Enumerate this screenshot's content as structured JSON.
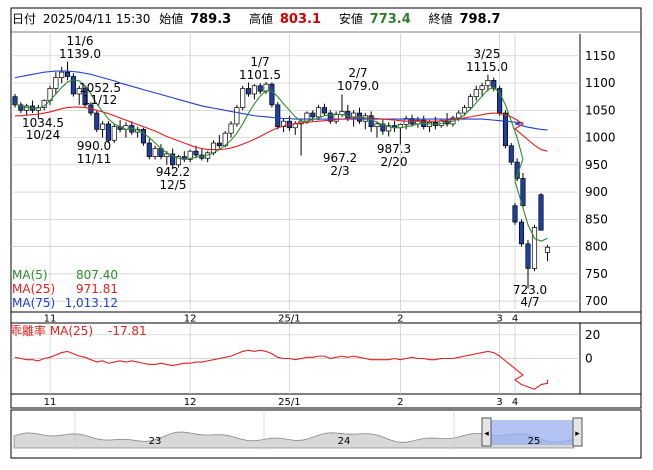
{
  "header": {
    "date_label": "日付",
    "date_value": "2025/04/11 15:30",
    "open_label": "始値",
    "open_value": "789.3",
    "high_label": "高値",
    "high_value": "803.1",
    "low_label": "安値",
    "low_value": "773.4",
    "close_label": "終値",
    "close_value": "798.7"
  },
  "colors": {
    "up_candle": "#ffffff",
    "down_candle": "#1f3f9f",
    "ma5": "#2e8b2e",
    "ma25": "#e02020",
    "ma75": "#2040d0",
    "deviation": "#e02020",
    "grid": "#c8c8c8",
    "scroller_fill": "#9ab0f0"
  },
  "chart_data": [
    {
      "type": "candlestick",
      "title": "",
      "ylim": [
        680,
        1190
      ],
      "y_ticks": [
        "1150",
        "1100",
        "1050",
        "1000",
        "950",
        "900",
        "850",
        "800",
        "750",
        "700"
      ],
      "x_labels": [
        "11",
        "12",
        "25/1",
        "2",
        "3",
        "4"
      ],
      "grid": true,
      "annotations": [
        {
          "price": "1139.0",
          "date": "11/6"
        },
        {
          "price": "1052.5",
          "date": "11/12"
        },
        {
          "price": "1034.5",
          "date": "10/24"
        },
        {
          "price": "990.0",
          "date": "11/11"
        },
        {
          "price": "942.2",
          "date": "12/5"
        },
        {
          "price": "1101.5",
          "date": "1/7"
        },
        {
          "price": "1079.0",
          "date": "2/7"
        },
        {
          "price": "967.2",
          "date": "2/3"
        },
        {
          "price": "987.3",
          "date": "2/20"
        },
        {
          "price": "1115.0",
          "date": "3/25"
        },
        {
          "price": "723.0",
          "date": "4/7"
        }
      ],
      "legend": [
        {
          "name": "MA(5)",
          "value": "807.40",
          "color": "#2e8b2e"
        },
        {
          "name": "MA(25)",
          "value": "971.81",
          "color": "#e02020"
        },
        {
          "name": "MA(75)",
          "value": "1,013.12",
          "color": "#2040d0"
        }
      ],
      "candles": [
        {
          "o": 1075,
          "h": 1080,
          "l": 1055,
          "c": 1060
        },
        {
          "o": 1060,
          "h": 1065,
          "l": 1045,
          "c": 1050
        },
        {
          "o": 1050,
          "h": 1062,
          "l": 1040,
          "c": 1058
        },
        {
          "o": 1058,
          "h": 1068,
          "l": 1045,
          "c": 1050
        },
        {
          "o": 1050,
          "h": 1060,
          "l": 1035,
          "c": 1055
        },
        {
          "o": 1055,
          "h": 1070,
          "l": 1050,
          "c": 1068
        },
        {
          "o": 1068,
          "h": 1095,
          "l": 1060,
          "c": 1090
        },
        {
          "o": 1090,
          "h": 1120,
          "l": 1080,
          "c": 1110
        },
        {
          "o": 1110,
          "h": 1130,
          "l": 1100,
          "c": 1120
        },
        {
          "o": 1120,
          "h": 1139,
          "l": 1105,
          "c": 1112
        },
        {
          "o": 1112,
          "h": 1118,
          "l": 1075,
          "c": 1080
        },
        {
          "o": 1080,
          "h": 1095,
          "l": 1060,
          "c": 1090
        },
        {
          "o": 1090,
          "h": 1095,
          "l": 1055,
          "c": 1060
        },
        {
          "o": 1060,
          "h": 1065,
          "l": 1040,
          "c": 1045
        },
        {
          "o": 1045,
          "h": 1050,
          "l": 1010,
          "c": 1015
        },
        {
          "o": 1015,
          "h": 1030,
          "l": 1000,
          "c": 1025
        },
        {
          "o": 1025,
          "h": 1030,
          "l": 990,
          "c": 995
        },
        {
          "o": 995,
          "h": 1025,
          "l": 990,
          "c": 1020
        },
        {
          "o": 1020,
          "h": 1032,
          "l": 1010,
          "c": 1015
        },
        {
          "o": 1015,
          "h": 1028,
          "l": 1000,
          "c": 1022
        },
        {
          "o": 1022,
          "h": 1030,
          "l": 1005,
          "c": 1010
        },
        {
          "o": 1010,
          "h": 1020,
          "l": 1000,
          "c": 1015
        },
        {
          "o": 1015,
          "h": 1018,
          "l": 985,
          "c": 990
        },
        {
          "o": 990,
          "h": 998,
          "l": 960,
          "c": 965
        },
        {
          "o": 965,
          "h": 985,
          "l": 960,
          "c": 980
        },
        {
          "o": 980,
          "h": 988,
          "l": 960,
          "c": 965
        },
        {
          "o": 965,
          "h": 975,
          "l": 950,
          "c": 970
        },
        {
          "o": 970,
          "h": 980,
          "l": 942,
          "c": 950
        },
        {
          "o": 950,
          "h": 968,
          "l": 945,
          "c": 965
        },
        {
          "o": 965,
          "h": 975,
          "l": 955,
          "c": 960
        },
        {
          "o": 960,
          "h": 978,
          "l": 955,
          "c": 975
        },
        {
          "o": 975,
          "h": 985,
          "l": 962,
          "c": 968
        },
        {
          "o": 968,
          "h": 980,
          "l": 958,
          "c": 962
        },
        {
          "o": 962,
          "h": 975,
          "l": 955,
          "c": 972
        },
        {
          "o": 972,
          "h": 995,
          "l": 968,
          "c": 990
        },
        {
          "o": 990,
          "h": 1005,
          "l": 980,
          "c": 985
        },
        {
          "o": 985,
          "h": 1012,
          "l": 982,
          "c": 1008
        },
        {
          "o": 1008,
          "h": 1030,
          "l": 1000,
          "c": 1025
        },
        {
          "o": 1025,
          "h": 1060,
          "l": 1020,
          "c": 1055
        },
        {
          "o": 1055,
          "h": 1095,
          "l": 1050,
          "c": 1090
        },
        {
          "o": 1090,
          "h": 1101,
          "l": 1075,
          "c": 1080
        },
        {
          "o": 1080,
          "h": 1098,
          "l": 1070,
          "c": 1095
        },
        {
          "o": 1095,
          "h": 1100,
          "l": 1080,
          "c": 1085
        },
        {
          "o": 1085,
          "h": 1102,
          "l": 1080,
          "c": 1098
        },
        {
          "o": 1098,
          "h": 1101,
          "l": 1055,
          "c": 1060
        },
        {
          "o": 1060,
          "h": 1065,
          "l": 1015,
          "c": 1020
        },
        {
          "o": 1020,
          "h": 1035,
          "l": 1010,
          "c": 1030
        },
        {
          "o": 1030,
          "h": 1040,
          "l": 1012,
          "c": 1018
        },
        {
          "o": 1018,
          "h": 1030,
          "l": 1005,
          "c": 1025
        },
        {
          "o": 1025,
          "h": 1035,
          "l": 967,
          "c": 1030
        },
        {
          "o": 1030,
          "h": 1048,
          "l": 1025,
          "c": 1045
        },
        {
          "o": 1045,
          "h": 1050,
          "l": 1030,
          "c": 1038
        },
        {
          "o": 1038,
          "h": 1060,
          "l": 1032,
          "c": 1055
        },
        {
          "o": 1055,
          "h": 1062,
          "l": 1040,
          "c": 1045
        },
        {
          "o": 1045,
          "h": 1050,
          "l": 1025,
          "c": 1030
        },
        {
          "o": 1030,
          "h": 1048,
          "l": 1025,
          "c": 1042
        },
        {
          "o": 1042,
          "h": 1079,
          "l": 1038,
          "c": 1048
        },
        {
          "o": 1048,
          "h": 1060,
          "l": 1030,
          "c": 1035
        },
        {
          "o": 1035,
          "h": 1050,
          "l": 1020,
          "c": 1045
        },
        {
          "o": 1045,
          "h": 1055,
          "l": 1025,
          "c": 1030
        },
        {
          "o": 1030,
          "h": 1045,
          "l": 1015,
          "c": 1040
        },
        {
          "o": 1040,
          "h": 1048,
          "l": 1010,
          "c": 1020
        },
        {
          "o": 1020,
          "h": 1030,
          "l": 1000,
          "c": 1025
        },
        {
          "o": 1025,
          "h": 1035,
          "l": 1005,
          "c": 1012
        },
        {
          "o": 1012,
          "h": 1028,
          "l": 1002,
          "c": 1022
        },
        {
          "o": 1022,
          "h": 1030,
          "l": 1010,
          "c": 1018
        },
        {
          "o": 1018,
          "h": 1026,
          "l": 987,
          "c": 1024
        },
        {
          "o": 1024,
          "h": 1040,
          "l": 1015,
          "c": 1035
        },
        {
          "o": 1035,
          "h": 1042,
          "l": 1020,
          "c": 1025
        },
        {
          "o": 1025,
          "h": 1038,
          "l": 1018,
          "c": 1032
        },
        {
          "o": 1032,
          "h": 1040,
          "l": 1015,
          "c": 1020
        },
        {
          "o": 1020,
          "h": 1032,
          "l": 1010,
          "c": 1028
        },
        {
          "o": 1028,
          "h": 1038,
          "l": 1015,
          "c": 1022
        },
        {
          "o": 1022,
          "h": 1035,
          "l": 1018,
          "c": 1030
        },
        {
          "o": 1030,
          "h": 1045,
          "l": 1020,
          "c": 1025
        },
        {
          "o": 1025,
          "h": 1040,
          "l": 1020,
          "c": 1036
        },
        {
          "o": 1036,
          "h": 1050,
          "l": 1030,
          "c": 1045
        },
        {
          "o": 1045,
          "h": 1060,
          "l": 1040,
          "c": 1055
        },
        {
          "o": 1055,
          "h": 1080,
          "l": 1050,
          "c": 1075
        },
        {
          "o": 1075,
          "h": 1095,
          "l": 1068,
          "c": 1088
        },
        {
          "o": 1088,
          "h": 1100,
          "l": 1075,
          "c": 1095
        },
        {
          "o": 1095,
          "h": 1115,
          "l": 1085,
          "c": 1105
        },
        {
          "o": 1105,
          "h": 1110,
          "l": 1085,
          "c": 1090
        },
        {
          "o": 1090,
          "h": 1095,
          "l": 1040,
          "c": 1045
        },
        {
          "o": 1045,
          "h": 1050,
          "l": 980,
          "c": 985
        },
        {
          "o": 985,
          "h": 990,
          "l": 950,
          "c": 955
        },
        {
          "o": 955,
          "h": 962,
          "l": 920,
          "c": 925
        },
        {
          "o": 925,
          "h": 935,
          "l": 870,
          "c": 875
        },
        {
          "o": 875,
          "h": 880,
          "l": 840,
          "c": 845
        },
        {
          "o": 845,
          "h": 850,
          "l": 800,
          "c": 805
        },
        {
          "o": 805,
          "h": 812,
          "l": 723,
          "c": 760
        },
        {
          "o": 760,
          "h": 840,
          "l": 755,
          "c": 835
        },
        {
          "o": 895,
          "h": 898,
          "l": 830,
          "c": 830
        },
        {
          "o": 789.3,
          "h": 803.1,
          "l": 773.4,
          "c": 798.7
        }
      ],
      "ma5": [
        1062,
        1058,
        1055,
        1054,
        1054,
        1058,
        1068,
        1080,
        1092,
        1102,
        1106,
        1104,
        1095,
        1080,
        1062,
        1048,
        1034,
        1025,
        1020,
        1015,
        1017,
        1014,
        1008,
        1000,
        990,
        980,
        972,
        967,
        962,
        960,
        962,
        964,
        966,
        968,
        972,
        978,
        986,
        995,
        1008,
        1025,
        1045,
        1062,
        1076,
        1086,
        1085,
        1075,
        1062,
        1050,
        1038,
        1030,
        1030,
        1033,
        1036,
        1040,
        1042,
        1043,
        1042,
        1040,
        1038,
        1038,
        1036,
        1033,
        1028,
        1024,
        1020,
        1018,
        1018,
        1020,
        1022,
        1025,
        1026,
        1025,
        1024,
        1026,
        1028,
        1030,
        1034,
        1042,
        1052,
        1064,
        1076,
        1088,
        1092,
        1082,
        1060,
        1030,
        1000,
        960,
        920,
        880,
        840,
        815,
        810,
        815,
        807.4
      ],
      "ma25": [
        1040,
        1040,
        1041,
        1042,
        1043,
        1045,
        1047,
        1050,
        1053,
        1055,
        1056,
        1056,
        1055,
        1053,
        1050,
        1047,
        1044,
        1040,
        1036,
        1032,
        1028,
        1024,
        1020,
        1016,
        1012,
        1007,
        1002,
        998,
        994,
        990,
        986,
        982,
        980,
        978,
        978,
        978,
        979,
        981,
        984,
        988,
        992,
        997,
        1002,
        1008,
        1013,
        1018,
        1021,
        1024,
        1026,
        1027,
        1028,
        1029,
        1030,
        1031,
        1032,
        1033,
        1034,
        1035,
        1036,
        1036,
        1036,
        1036,
        1035,
        1034,
        1033,
        1032,
        1031,
        1030,
        1030,
        1030,
        1030,
        1030,
        1030,
        1031,
        1032,
        1033,
        1034,
        1036,
        1038,
        1040,
        1042,
        1044,
        1045,
        1044,
        1042,
        1038,
        1032,
        1025,
        1016,
        1006,
        996,
        986,
        978,
        975,
        971.81
      ],
      "ma75": [
        1110,
        1112,
        1114,
        1116,
        1118,
        1120,
        1121,
        1122,
        1122,
        1122,
        1121,
        1120,
        1118,
        1116,
        1113,
        1110,
        1107,
        1104,
        1100,
        1097,
        1094,
        1091,
        1088,
        1085,
        1082,
        1079,
        1076,
        1073,
        1070,
        1067,
        1064,
        1061,
        1058,
        1056,
        1054,
        1052,
        1050,
        1048,
        1046,
        1044,
        1042,
        1040,
        1039,
        1038,
        1037,
        1036,
        1035,
        1035,
        1034,
        1034,
        1034,
        1034,
        1034,
        1034,
        1034,
        1034,
        1034,
        1034,
        1034,
        1034,
        1034,
        1034,
        1034,
        1034,
        1034,
        1034,
        1034,
        1034,
        1034,
        1034,
        1034,
        1034,
        1034,
        1034,
        1034,
        1034,
        1034,
        1034,
        1034,
        1034,
        1034,
        1033,
        1032,
        1031,
        1030,
        1029,
        1028,
        1027,
        1025,
        1022,
        1019,
        1017,
        1015,
        1014,
        1013.12
      ]
    },
    {
      "type": "line",
      "title": "",
      "legend": [
        {
          "name": "乖離率 MA(25)",
          "value": "-17.81",
          "color": "#e02020"
        }
      ],
      "y_ticks": [
        "20",
        "0"
      ],
      "ylim": [
        -30,
        30
      ],
      "x_labels": [
        "11",
        "12",
        "25/1",
        "2",
        "3",
        "4"
      ],
      "values": [
        1,
        0,
        -1,
        -1,
        -2,
        0,
        1,
        3,
        5,
        6,
        4,
        2,
        1,
        -1,
        -3,
        -2,
        -4,
        -3,
        -2,
        -3,
        -2,
        -3,
        -4,
        -5,
        -5,
        -4,
        -5,
        -6,
        -5,
        -4,
        -4,
        -3,
        -3,
        -2,
        -1,
        0,
        1,
        2,
        4,
        6,
        7,
        6,
        7,
        6,
        4,
        1,
        0,
        0,
        -1,
        0,
        1,
        1,
        2,
        2,
        0,
        1,
        2,
        1,
        2,
        1,
        0,
        -1,
        -1,
        -1,
        -1,
        0,
        -1,
        0,
        1,
        0,
        0,
        -1,
        -1,
        0,
        0,
        0,
        1,
        2,
        3,
        4,
        5,
        6,
        5,
        2,
        -2,
        -6,
        -10,
        -14,
        -18,
        -22,
        -24,
        -26,
        -22,
        -21,
        -17.81
      ]
    },
    {
      "type": "area",
      "title": "",
      "x_labels": [
        "23",
        "24",
        "25"
      ]
    }
  ]
}
